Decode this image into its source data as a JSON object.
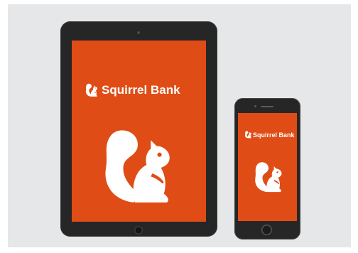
{
  "brand": {
    "name": "Squirrel Bank",
    "primary_color": "#e04c16",
    "logo_icon": "squirrel-icon"
  },
  "devices": {
    "tablet": {
      "screen_text": "Squirrel Bank",
      "hero_icon": "squirrel-icon"
    },
    "phone": {
      "screen_text": "Squirrel Bank",
      "hero_icon": "squirrel-icon"
    }
  }
}
